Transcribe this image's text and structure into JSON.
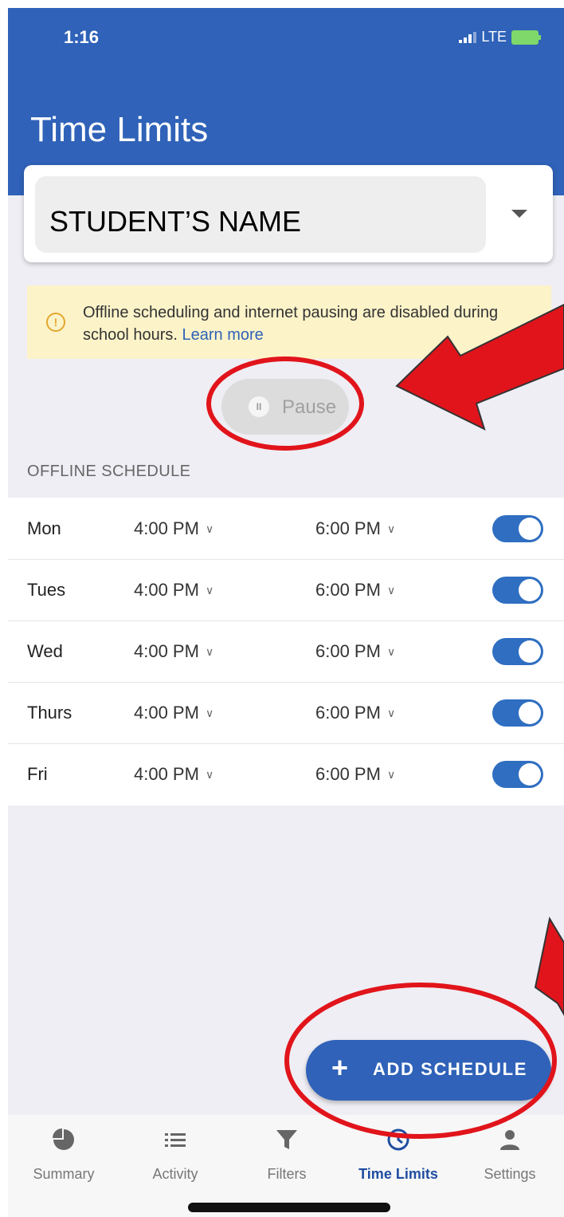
{
  "status_bar": {
    "time": "1:16",
    "network": "LTE"
  },
  "header": {
    "title": "Time Limits"
  },
  "student_selector": {
    "name": "STUDENT’S NAME"
  },
  "notice": {
    "text": "Offline scheduling and internet pausing are disabled during school hours.",
    "link": "Learn more"
  },
  "pause_button": {
    "label": "Pause"
  },
  "offline_schedule": {
    "section_label": "OFFLINE SCHEDULE",
    "rows": [
      {
        "day": "Mon",
        "start": "4:00 PM",
        "end": "6:00 PM",
        "enabled": true
      },
      {
        "day": "Tues",
        "start": "4:00 PM",
        "end": "6:00 PM",
        "enabled": true
      },
      {
        "day": "Wed",
        "start": "4:00 PM",
        "end": "6:00 PM",
        "enabled": true
      },
      {
        "day": "Thurs",
        "start": "4:00 PM",
        "end": "6:00 PM",
        "enabled": true
      },
      {
        "day": "Fri",
        "start": "4:00 PM",
        "end": "6:00 PM",
        "enabled": true
      }
    ]
  },
  "add_schedule": {
    "plus": "+",
    "label": "ADD SCHEDULE"
  },
  "bottom_nav": {
    "tabs": [
      {
        "label": "Summary",
        "icon": "pie-chart-icon",
        "active": false
      },
      {
        "label": "Activity",
        "icon": "list-icon",
        "active": false
      },
      {
        "label": "Filters",
        "icon": "filter-icon",
        "active": false
      },
      {
        "label": "Time Limits",
        "icon": "clock-icon",
        "active": true
      },
      {
        "label": "Settings",
        "icon": "person-icon",
        "active": false
      }
    ]
  },
  "colors": {
    "primary": "#2f62b8",
    "annotation": "#e1141b",
    "notice_bg": "#fcf3c9"
  }
}
